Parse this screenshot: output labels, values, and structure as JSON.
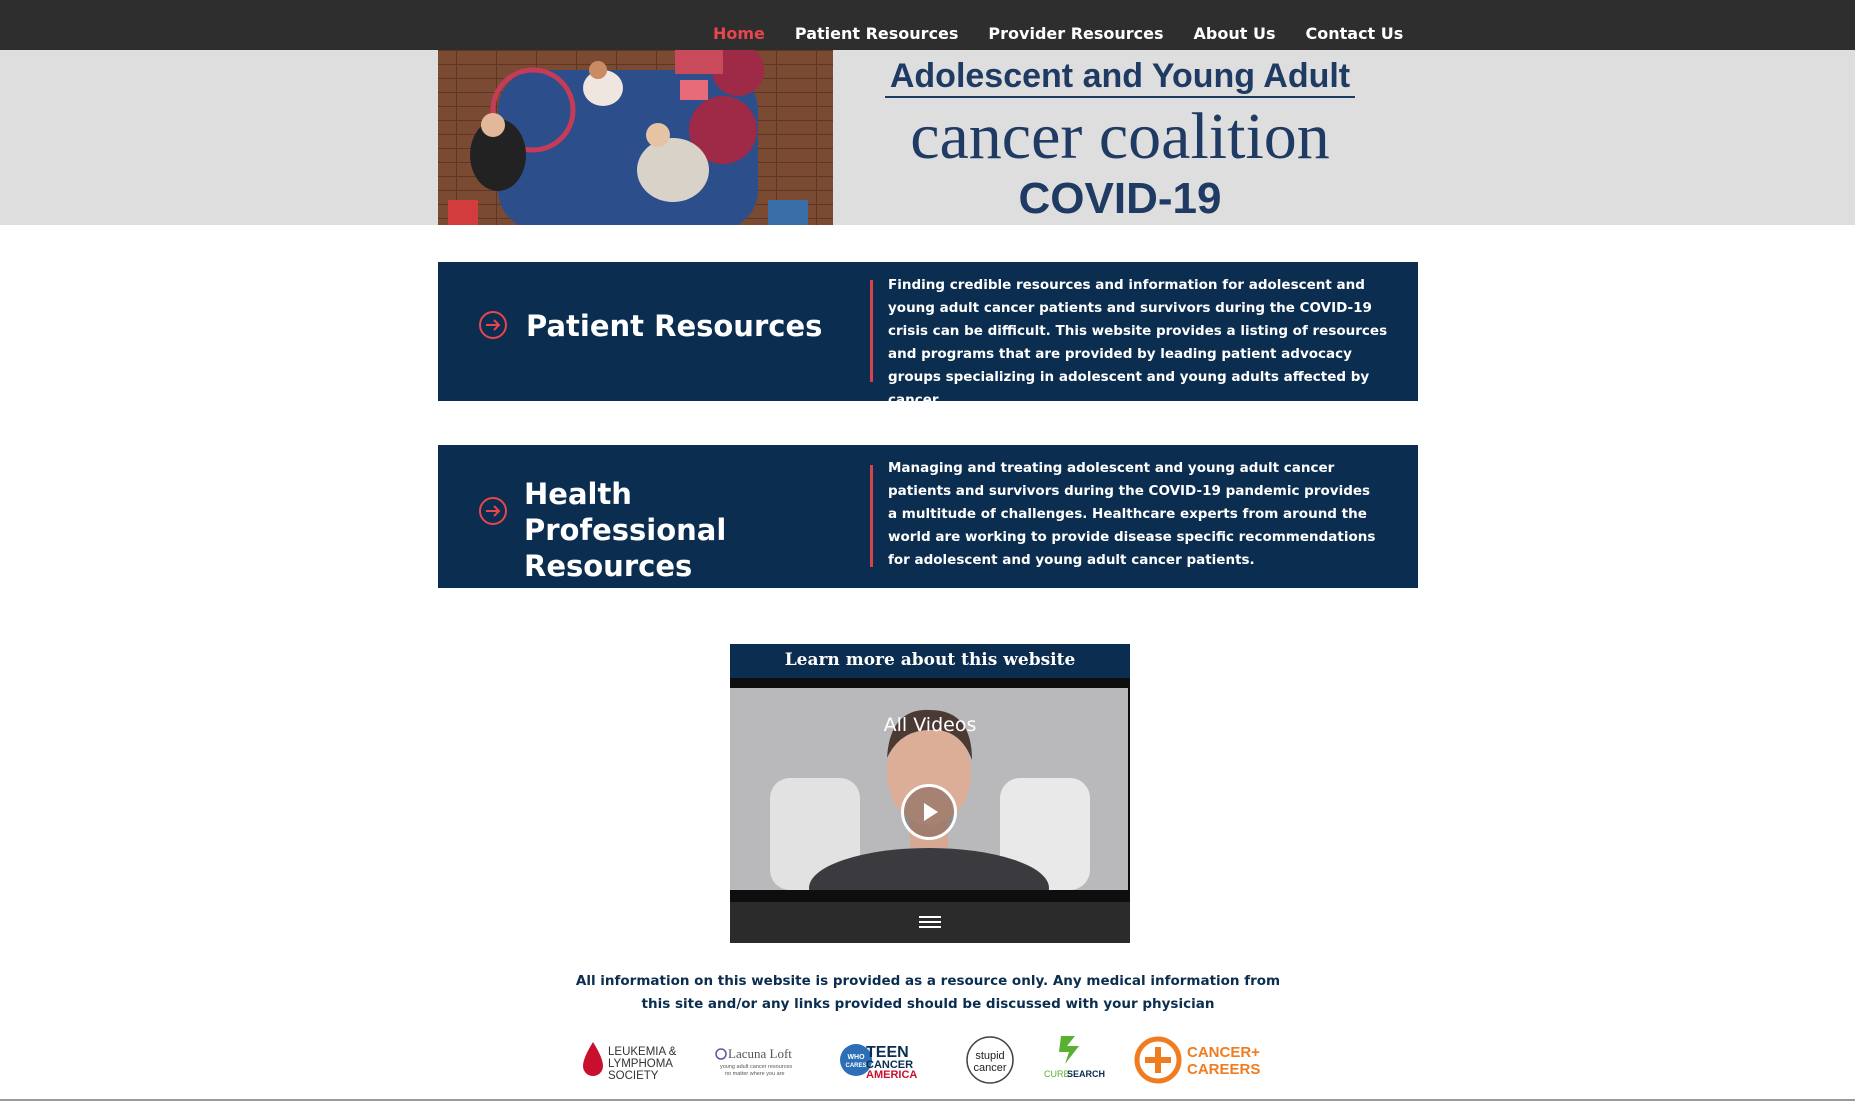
{
  "nav": {
    "items": [
      {
        "label": "Home",
        "active": true
      },
      {
        "label": "Patient Resources",
        "active": false
      },
      {
        "label": "Provider Resources",
        "active": false
      },
      {
        "label": "About Us",
        "active": false
      },
      {
        "label": "Contact Us",
        "active": false
      }
    ]
  },
  "banner": {
    "brand_line1": "Adolescent and Young Adult",
    "brand_line2": "cancer coalition",
    "brand_line3": "COVID-19"
  },
  "cards": [
    {
      "title": "Patient Resources",
      "description": "Finding credible resources and information for adolescent and young adult cancer patients and survivors during the COVID-19 crisis can be difficult. This website provides a listing of resources and programs that are provided by leading patient advocacy groups specializing in adolescent and young adults affected by cancer."
    },
    {
      "title": "Health Professional Resources",
      "description": "Managing and treating adolescent and young adult cancer patients and survivors during the COVID-19 pandemic provides a multitude of challenges. Healthcare experts from around the world are working to provide disease specific recommendations for adolescent and young adult cancer patients."
    }
  ],
  "video": {
    "title": "Learn more about this website",
    "caption": "All Videos"
  },
  "disclaimer": "All information on this website is provided as a resource only.  Any medical information from this site and/or any links  provided should be discussed with your physician",
  "partners": {
    "lls_line1": "LEUKEMIA &",
    "lls_line2": "LYMPHOMA",
    "lls_line3": "SOCIETY",
    "lacuna_name": "Lacuna Loft",
    "lacuna_tag1": "young adult cancer resources",
    "lacuna_tag2": "no matter where you are",
    "tca_who": "WHO",
    "tca_cares": "CARES",
    "tca_teen": "TEEN",
    "tca_cancer": "CANCER",
    "tca_america": "AMERICA",
    "stupid_line1": "stupid",
    "stupid_line2": "cancer",
    "curesearch_cure": "CURE",
    "curesearch_search": "SEARCH",
    "cc_line1": "CANCER+",
    "cc_line2": "CAREERS"
  },
  "colors": {
    "navy": "#0b2d4f",
    "accent_red": "#e8454f",
    "nav_bg": "#2e2e2e",
    "banner_bg": "#dedede",
    "orange": "#f07c21",
    "green": "#5ab031"
  }
}
